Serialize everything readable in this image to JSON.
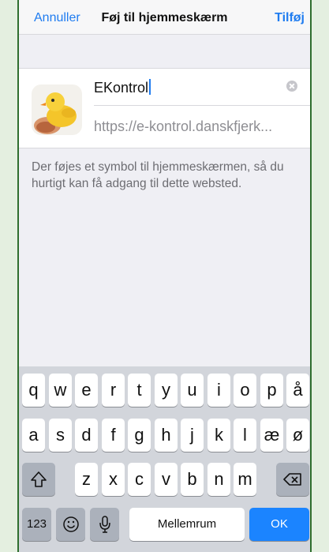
{
  "nav": {
    "cancel": "Annuller",
    "title": "Føj til hjemmeskærm",
    "add": "Tilføj"
  },
  "form": {
    "icon": "chick-app-icon",
    "name_value": "EKontrol",
    "url": "https://e-kontrol.danskfjerk..."
  },
  "info_text": "Der føjes et symbol til hjemmeskærmen, så du hurtigt kan få adgang til dette websted.",
  "keyboard": {
    "row1": [
      "q",
      "w",
      "e",
      "r",
      "t",
      "y",
      "u",
      "i",
      "o",
      "p",
      "å"
    ],
    "row2": [
      "a",
      "s",
      "d",
      "f",
      "g",
      "h",
      "j",
      "k",
      "l",
      "æ",
      "ø"
    ],
    "row3": [
      "z",
      "x",
      "c",
      "v",
      "b",
      "n",
      "m"
    ],
    "numbers_label": "123",
    "space_label": "Mellemrum",
    "ok_label": "OK",
    "icons": [
      "shift-icon",
      "backspace-icon",
      "emoji-icon",
      "microphone-icon"
    ]
  },
  "colors": {
    "accent": "#1f7cf0",
    "ok_key": "#1b84ff",
    "frame": "#2f6e2f"
  }
}
